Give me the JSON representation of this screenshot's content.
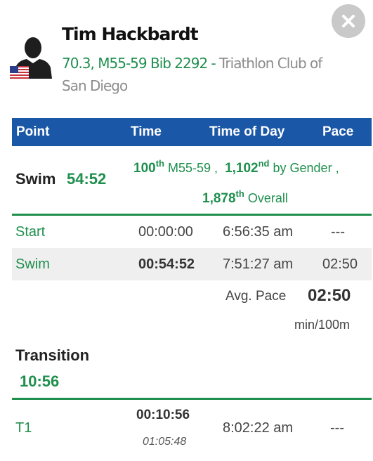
{
  "athlete": {
    "name": "Tim Hackbardt",
    "race_division_bib": "70.3, M55-59 Bib 2292",
    "separator": " - ",
    "club": "Triathlon Club of San Diego",
    "country_flag": "us-flag-icon"
  },
  "table_header": {
    "point": "Point",
    "time": "Time",
    "time_of_day": "Time of Day",
    "pace": "Pace"
  },
  "swim": {
    "label": "Swim",
    "total": "54:52",
    "division_rank": "100",
    "division_rank_suffix": "th",
    "division_label": "M55-59 ,",
    "gender_rank": "1,102",
    "gender_rank_suffix": "nd",
    "gender_label": "by Gender ,",
    "overall_rank": "1,878",
    "overall_rank_suffix": "th",
    "overall_label": "Overall",
    "splits": [
      {
        "point": "Start",
        "time": "00:00:00",
        "time_of_day": "6:56:35 am",
        "pace": "---"
      },
      {
        "point": "Swim",
        "time": "00:54:52",
        "time_of_day": "7:51:27 am",
        "pace": "02:50"
      }
    ],
    "avg_pace_label": "Avg. Pace",
    "avg_pace_value": "02:50",
    "avg_pace_unit": "min/100m"
  },
  "transition": {
    "label": "Transition",
    "total": "10:56",
    "splits": [
      {
        "point": "T1",
        "time": "00:10:56",
        "cumulative": "01:05:48",
        "time_of_day": "8:02:22 am",
        "pace": "---"
      }
    ]
  },
  "colors": {
    "accent_green": "#1f8f4e",
    "header_blue": "#1b57a7",
    "muted_text": "#8c8c8c"
  }
}
